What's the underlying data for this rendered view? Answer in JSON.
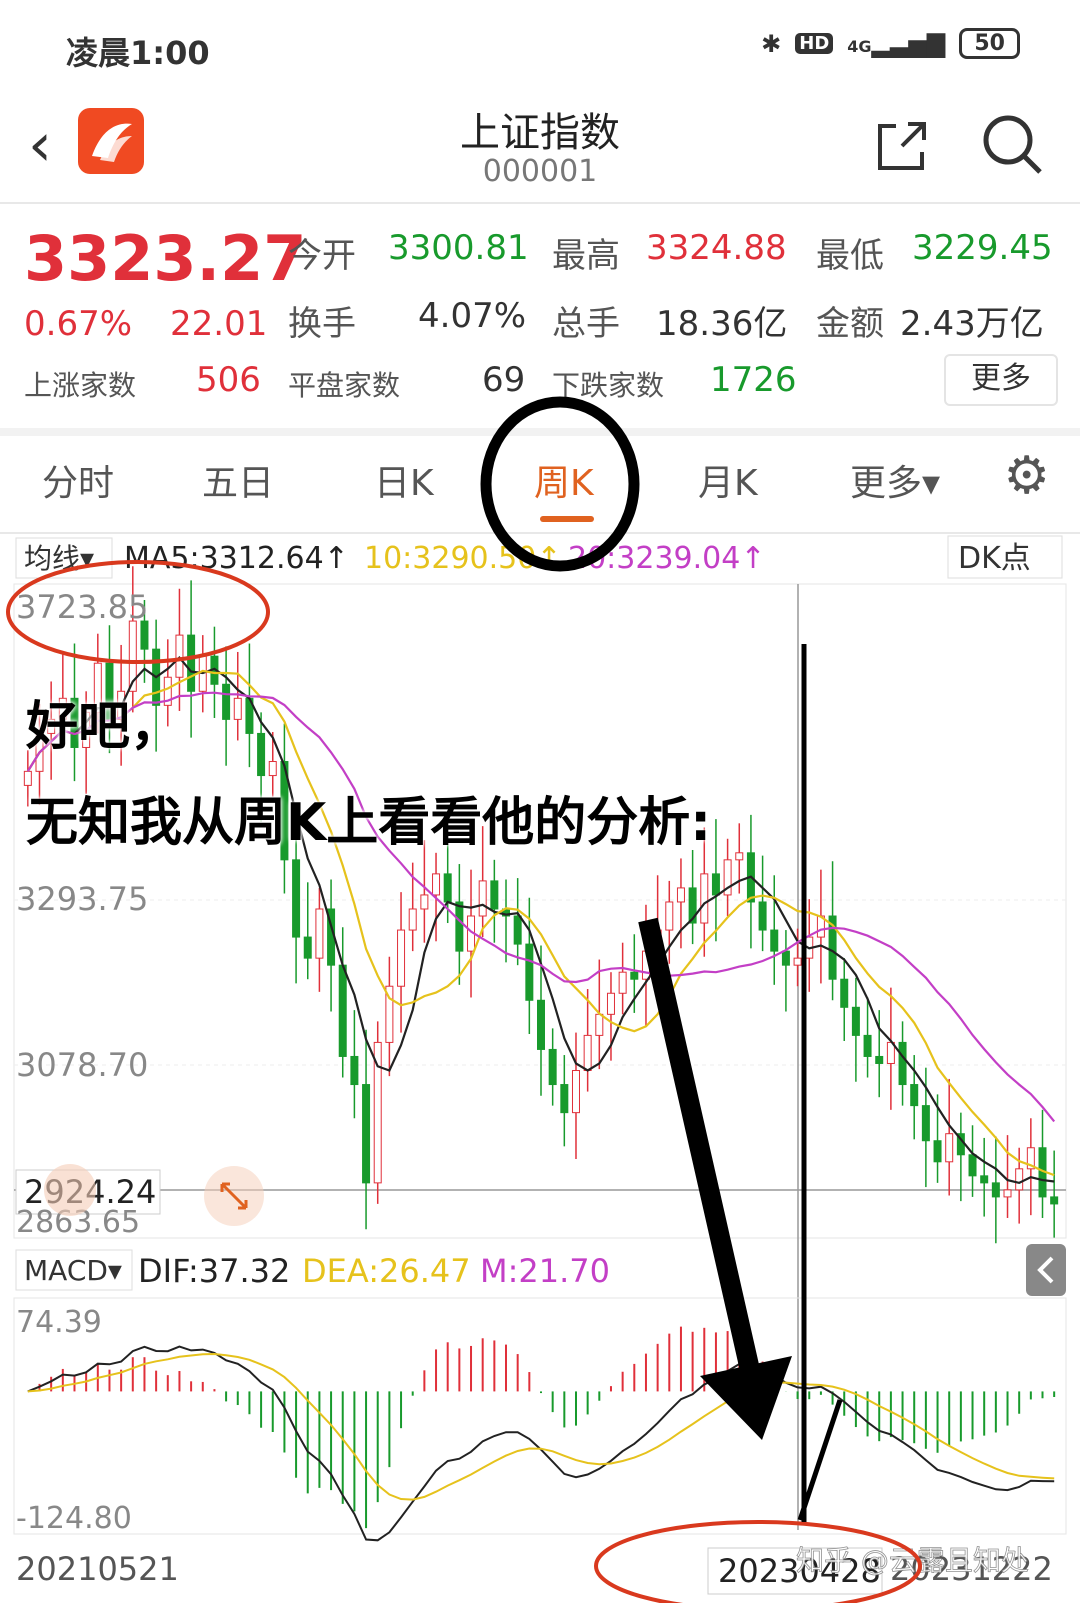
{
  "status": {
    "time": "凌晨1:00",
    "bluetooth": "✱",
    "hd": "HD",
    "network": "4G",
    "battery": "50"
  },
  "header": {
    "title": "上证指数",
    "code": "000001",
    "back_icon": "chevron-left",
    "share_icon": "share",
    "search_icon": "search"
  },
  "quote": {
    "price": "3323.27",
    "change_pct": "0.67%",
    "change_abs": "22.01",
    "open_label": "今开",
    "open": "3300.81",
    "high_label": "最高",
    "high": "3324.88",
    "low_label": "最低",
    "low": "3229.45",
    "turnover_label": "换手",
    "turnover": "4.07%",
    "volume_label": "总手",
    "volume": "18.36亿",
    "amount_label": "金额",
    "amount": "2.43万亿",
    "up_label": "上涨家数",
    "up": "506",
    "flat_label": "平盘家数",
    "flat": "69",
    "down_label": "下跌家数",
    "down": "1726",
    "more": "更多"
  },
  "tabs": {
    "t1": "分时",
    "t2": "五日",
    "t3": "日K",
    "t4": "周K",
    "t5": "月K",
    "t6": "更多▾",
    "active": "周K"
  },
  "ma": {
    "selector": "均线▾",
    "ma5": "MA5:3312.64↑",
    "ma10": "10:3290.50↑",
    "ma20": "20:3239.04↑",
    "dk": "DK点"
  },
  "price_axis": {
    "p1": "3723.85",
    "p2": "3293.75",
    "p3": "3078.70",
    "p4": "2924.24",
    "p5": "2863.65"
  },
  "macd": {
    "selector": "MACD▾",
    "dif": "DIF:37.32",
    "dea": "DEA:26.47",
    "m": "M:21.70",
    "top": "74.39",
    "bottom": "-124.80"
  },
  "dates": {
    "start": "20210521",
    "mid": "20230428",
    "end": "20231222"
  },
  "overlay": {
    "line1": "好吧，",
    "line2": "无知我从周K上看看他的分析:"
  },
  "watermark": "知乎 @云露且知处",
  "colors": {
    "up": "#e0303a",
    "down": "#189a2c",
    "ma5": "#222222",
    "ma10": "#e6c21c",
    "ma20": "#c33fc6",
    "accent": "#e06220"
  },
  "chart_data": {
    "type": "candlestick",
    "period": "weekly",
    "x_range": [
      "20210521",
      "20231222"
    ],
    "y_range": [
      2863.65,
      3723.85
    ],
    "ma": [
      {
        "name": "MA5",
        "value": 3312.64
      },
      {
        "name": "10",
        "value": 3290.5
      },
      {
        "name": "20",
        "value": 3239.04
      }
    ],
    "closes": [
      3486,
      3540,
      3560,
      3590,
      3520,
      3570,
      3640,
      3560,
      3600,
      3700,
      3660,
      3580,
      3620,
      3680,
      3600,
      3650,
      3610,
      3560,
      3590,
      3540,
      3480,
      3500,
      3360,
      3250,
      3220,
      3290,
      3210,
      3080,
      3040,
      2900,
      3100,
      3180,
      3260,
      3290,
      3310,
      3340,
      3300,
      3230,
      3280,
      3330,
      3290,
      3280,
      3240,
      3160,
      3090,
      3040,
      3000,
      3060,
      3110,
      3140,
      3170,
      3200,
      3190,
      3230,
      3260,
      3300,
      3320,
      3270,
      3340,
      3310,
      3360,
      3370,
      3300,
      3260,
      3230,
      3210,
      3220,
      3250,
      3280,
      3190,
      3150,
      3110,
      3080,
      3070,
      3100,
      3040,
      3010,
      2960,
      2930,
      2970,
      2940,
      2910,
      2900,
      2880,
      2890,
      2920,
      2950,
      2880,
      2870
    ],
    "macd": {
      "dif": 37.32,
      "dea": 26.47,
      "m": 21.7,
      "range": [
        -124.8,
        74.39
      ]
    }
  }
}
